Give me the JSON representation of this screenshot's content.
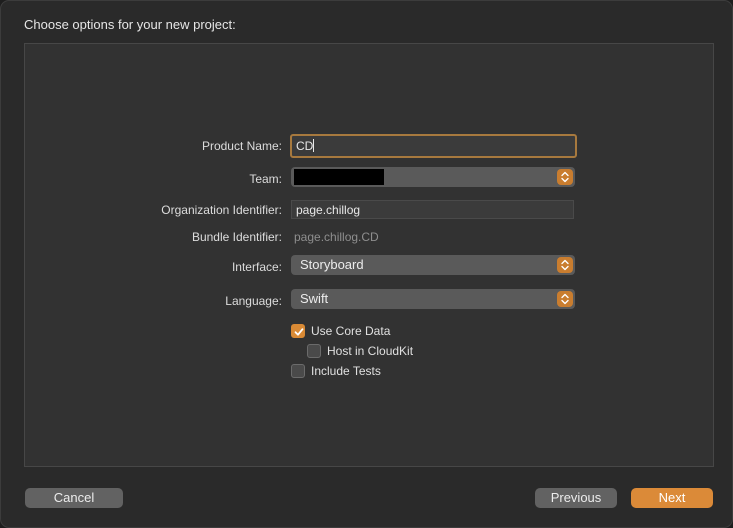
{
  "sheet": {
    "title": "Choose options for your new project:"
  },
  "form": {
    "product_name": {
      "label": "Product Name:",
      "value": "CD"
    },
    "team": {
      "label": "Team:",
      "value": ""
    },
    "organization_identifier": {
      "label": "Organization Identifier:",
      "value": "page.chillog"
    },
    "bundle_identifier": {
      "label": "Bundle Identifier:",
      "value": "page.chillog.CD"
    },
    "interface": {
      "label": "Interface:",
      "selected": "Storyboard"
    },
    "language": {
      "label": "Language:",
      "selected": "Swift"
    },
    "options": {
      "use_core_data": {
        "label": "Use Core Data",
        "checked": true
      },
      "host_in_cloudkit": {
        "label": "Host in CloudKit",
        "checked": false
      },
      "include_tests": {
        "label": "Include Tests",
        "checked": false
      }
    }
  },
  "buttons": {
    "cancel": "Cancel",
    "previous": "Previous",
    "next": "Next"
  },
  "colors": {
    "accent": "#db8a38",
    "focus_ring": "#a7793e",
    "panel": "#323232",
    "window": "#2a2a2a"
  },
  "icons": {
    "popup_stepper": "chevron-up-down-icon",
    "checkbox_check": "checkmark-icon"
  }
}
